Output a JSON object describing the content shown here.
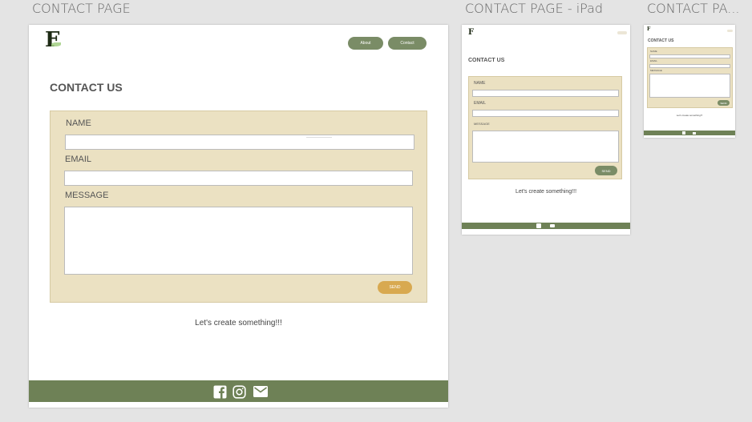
{
  "artboards": [
    {
      "title": "CONTACT PAGE"
    },
    {
      "title": "CONTACT PAGE - iPad"
    },
    {
      "title": "CONTACT PA..."
    }
  ],
  "logo": {
    "letter": "F"
  },
  "nav": {
    "about": "About",
    "contact": "Contact"
  },
  "page": {
    "heading": "CONTACT US",
    "labels": {
      "name": "NAME",
      "email": "EMAIL",
      "message": "MESSAGE"
    },
    "send": "SEND",
    "tagline": "Let's create something!!!"
  },
  "colors": {
    "footer": "#6e8156",
    "form_bg": "#ebe1c2",
    "send": "#d8a950",
    "nav": "#7a8c66"
  },
  "footer_icons": [
    "facebook-icon",
    "instagram-icon",
    "mail-icon"
  ]
}
